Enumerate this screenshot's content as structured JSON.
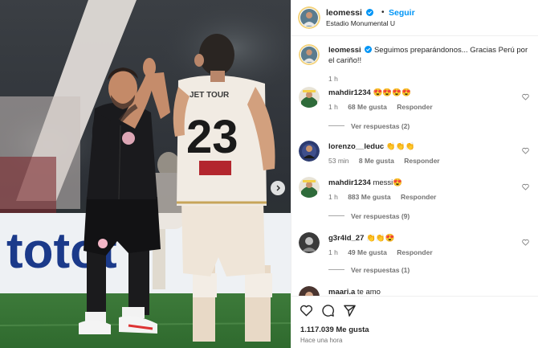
{
  "header": {
    "username": "leomessi",
    "follow_label": "Seguir",
    "separator": "•",
    "location": "Estadio Monumental U"
  },
  "photo": {
    "description_icon": "photo-carousel",
    "jersey_number": "23",
    "sponsor_text": "JET TOUR",
    "board_text": "totot",
    "next_icon": "chevron-right-icon"
  },
  "caption": {
    "username": "leomessi",
    "text": "Seguimos preparándonos... Gracias Perú por el cariño!!",
    "time": "1 h"
  },
  "comments": [
    {
      "username": "mahdir1234",
      "text": "😍😍😍😍",
      "time": "1 h",
      "likes": "68 Me gusta",
      "reply": "Responder",
      "replies": "Ver respuestas (2)"
    },
    {
      "username": "lorenzo__leduc",
      "text": "👏👏👏",
      "time": "53 min",
      "likes": "8 Me gusta",
      "reply": "Responder",
      "replies": ""
    },
    {
      "username": "mahdir1234",
      "text": "messi😍",
      "time": "1 h",
      "likes": "883 Me gusta",
      "reply": "Responder",
      "replies": "Ver respuestas (9)"
    },
    {
      "username": "g3r4ld_27",
      "text": "👏👏😍",
      "time": "1 h",
      "likes": "49 Me gusta",
      "reply": "Responder",
      "replies": "Ver respuestas (1)"
    },
    {
      "username": "maari.a",
      "text": "te amo",
      "time": "",
      "likes": "",
      "reply": "",
      "replies": ""
    }
  ],
  "footer": {
    "likes_total": "1.117.039 Me gusta",
    "posted": "Hace una hora"
  },
  "colors": {
    "accent": "#0095f6",
    "text": "#262626",
    "muted": "#737373"
  }
}
